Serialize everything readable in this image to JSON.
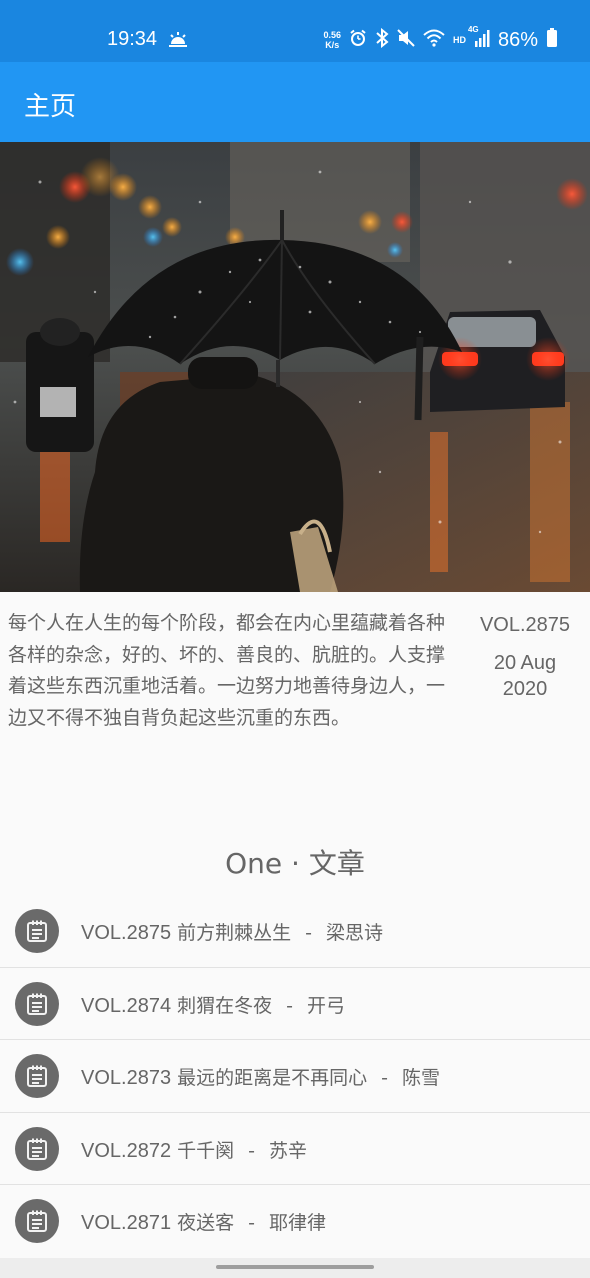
{
  "status_bar": {
    "time": "19:34",
    "net_speed_value": "0.56",
    "net_speed_unit": "K/s",
    "hd_label": "HD",
    "network_type": "4G",
    "battery": "86%",
    "icons": [
      "weather-sun-icon",
      "alarm-icon",
      "bluetooth-icon",
      "mute-icon",
      "wifi-icon",
      "signal-icon",
      "battery-icon"
    ]
  },
  "app_bar": {
    "title": "主页"
  },
  "hero_image": {
    "subject": "person-with-umbrella-rainy-street"
  },
  "daily": {
    "summary": "每个人在人生的每个阶段，都会在内心里蕴藏着各种各样的杂念，好的、坏的、善良的、肮脏的。人支撑着这些东西沉重地活着。一边努力地善待身边人，一边又不得不独自背负起这些沉重的东西。",
    "vol": "VOL.2875",
    "date": "20 Aug\n2020"
  },
  "section": {
    "title": "One · 文章"
  },
  "articles": [
    {
      "vol": "VOL.2875",
      "title": "前方荆棘丛生",
      "sep": "-",
      "author": "梁思诗"
    },
    {
      "vol": "VOL.2874",
      "title": "刺猬在冬夜",
      "sep": "-",
      "author": "开弓"
    },
    {
      "vol": "VOL.2873",
      "title": "最远的距离是不再同心",
      "sep": "-",
      "author": "陈雪"
    },
    {
      "vol": "VOL.2872",
      "title": "千千阕",
      "sep": "-",
      "author": "苏辛"
    },
    {
      "vol": "VOL.2871",
      "title": "夜送客",
      "sep": "-",
      "author": "耶律律"
    }
  ],
  "colors": {
    "status_bar": "#1a86e0",
    "app_bar": "#2196f3",
    "text_secondary": "#666666",
    "icon_circle": "#6a6a6a"
  }
}
